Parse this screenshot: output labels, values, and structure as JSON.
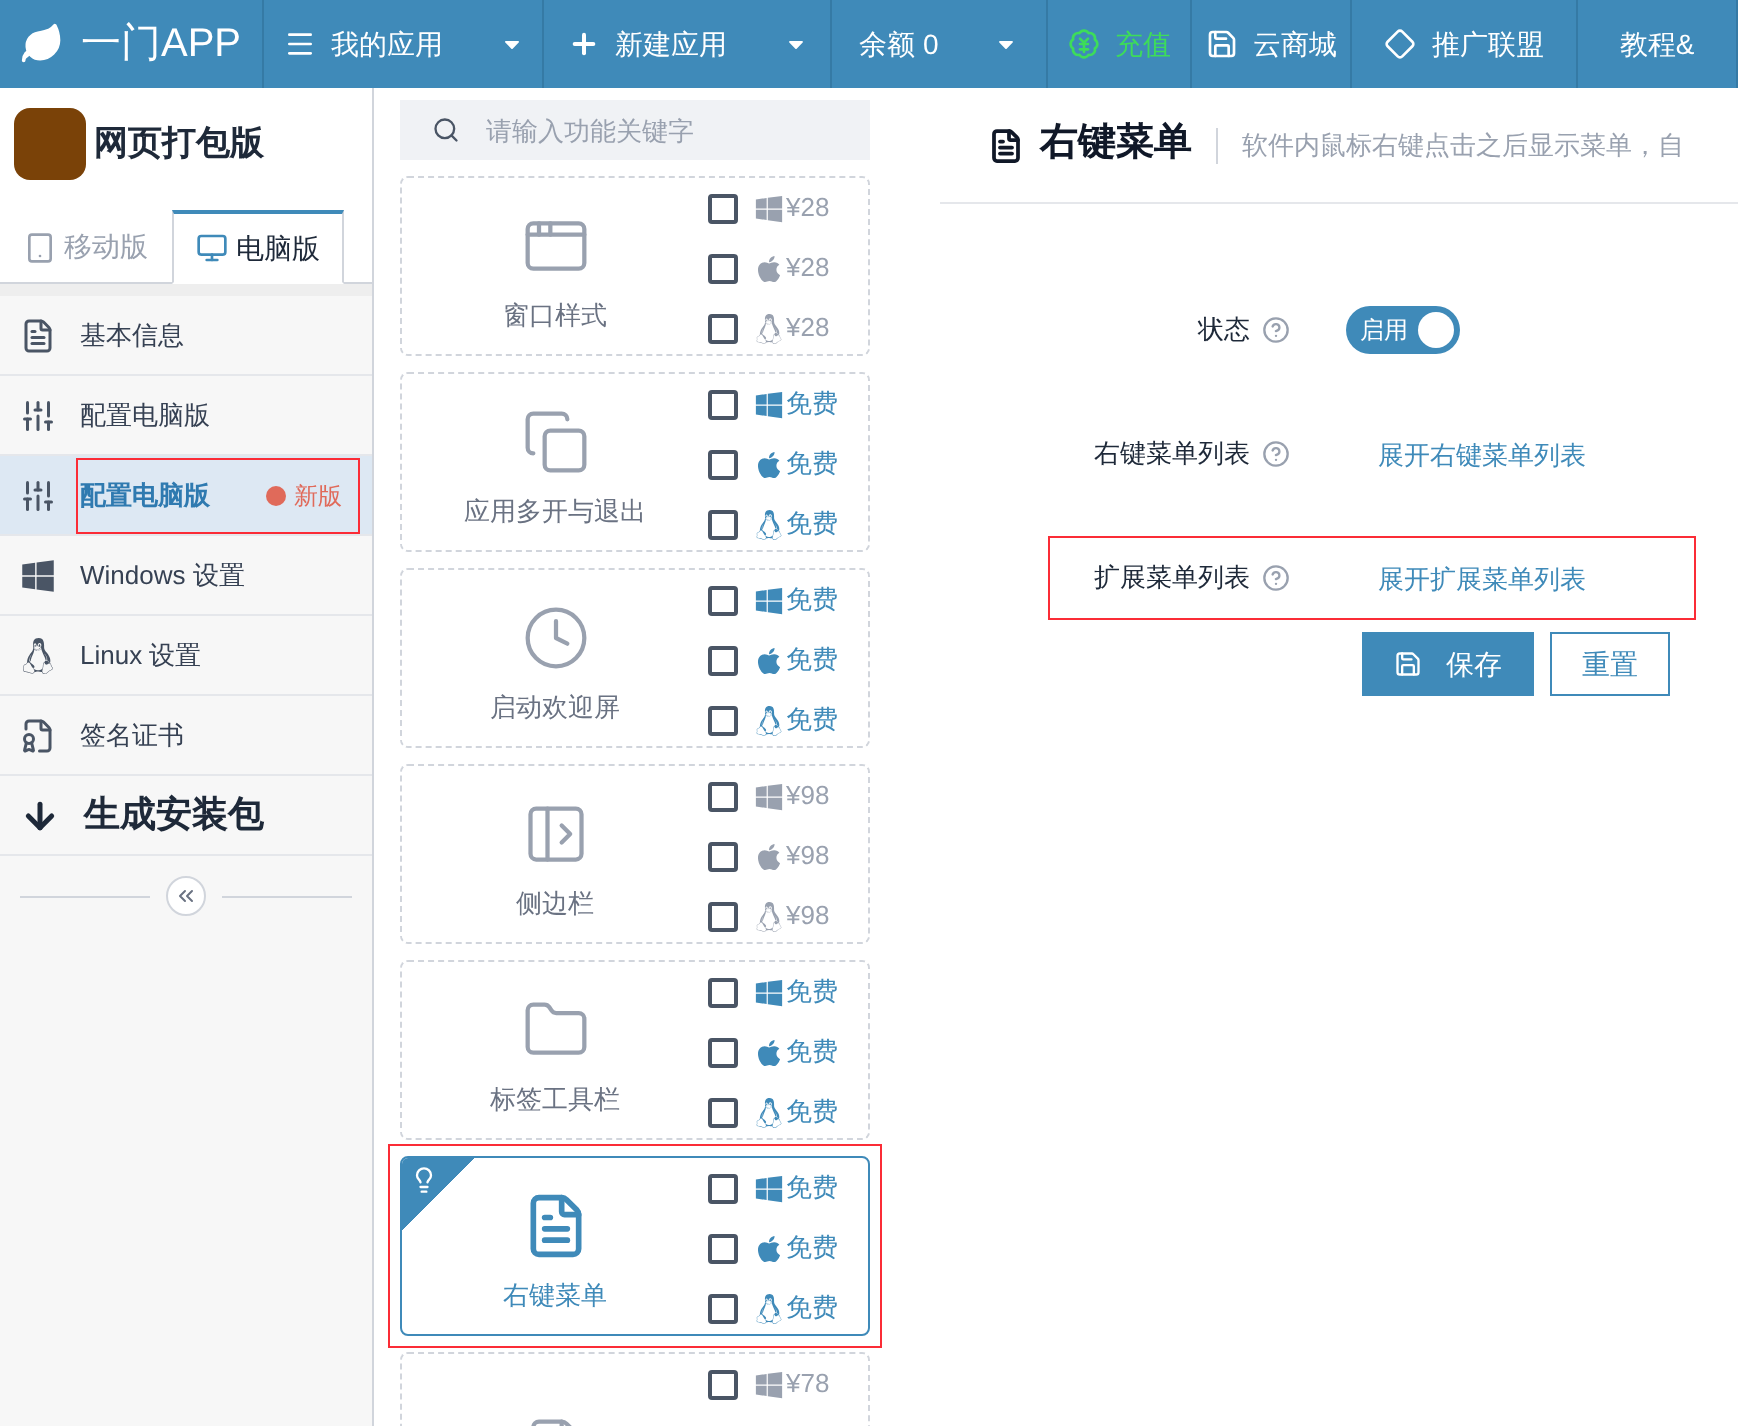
{
  "nav": {
    "logo": "一门APP",
    "items": [
      {
        "label": "我的应用",
        "kind": "apps",
        "dropdown": true
      },
      {
        "label": "新建应用",
        "kind": "new",
        "dropdown": true
      },
      {
        "label": "余额 0",
        "kind": "balance",
        "dropdown": true
      },
      {
        "label": "充值",
        "kind": "recharge",
        "dropdown": false
      },
      {
        "label": "云商城",
        "kind": "store",
        "dropdown": false
      },
      {
        "label": "推广联盟",
        "kind": "affiliate",
        "dropdown": false
      },
      {
        "label": "教程&",
        "kind": "plain",
        "dropdown": false
      }
    ]
  },
  "sidebar": {
    "app_name": "网页打包版",
    "tabs": [
      {
        "label": "移动版",
        "kind": "mobile",
        "selected": false
      },
      {
        "label": "电脑版",
        "kind": "desktop",
        "selected": true
      }
    ],
    "items": [
      {
        "label": "基本信息",
        "kind": "info",
        "selected": false,
        "highlighted": false
      },
      {
        "label": "配置电脑版",
        "kind": "config",
        "selected": false,
        "highlighted": false
      },
      {
        "label": "配置电脑版",
        "kind": "config",
        "selected": true,
        "highlighted": true,
        "badge": "新版"
      },
      {
        "label": "Windows 设置",
        "kind": "windows",
        "selected": false,
        "highlighted": false
      },
      {
        "label": "Linux 设置",
        "kind": "linux",
        "selected": false,
        "highlighted": false
      },
      {
        "label": "签名证书",
        "kind": "cert",
        "selected": false,
        "highlighted": false
      },
      {
        "label": "生成安装包",
        "kind": "build",
        "selected": false,
        "highlighted": false
      }
    ]
  },
  "features": {
    "search": {
      "placeholder": "请输入功能关键字"
    },
    "cards": [
      {
        "name": "窗口样式",
        "kind": "window",
        "selected": false,
        "highlighted": false,
        "options": [
          {
            "kind": "windows",
            "price": "¥28",
            "paid": true,
            "checked": false
          },
          {
            "kind": "apple",
            "price": "¥28",
            "paid": true,
            "checked": false
          },
          {
            "kind": "linux",
            "price": "¥28",
            "paid": true,
            "checked": false
          }
        ]
      },
      {
        "name": "应用多开与退出",
        "kind": "multi",
        "selected": false,
        "highlighted": false,
        "options": [
          {
            "kind": "windows",
            "price": "免费",
            "paid": false,
            "checked": false
          },
          {
            "kind": "apple",
            "price": "免费",
            "paid": false,
            "checked": false
          },
          {
            "kind": "linux",
            "price": "免费",
            "paid": false,
            "checked": false
          }
        ]
      },
      {
        "name": "启动欢迎屏",
        "kind": "clock",
        "selected": false,
        "highlighted": false,
        "options": [
          {
            "kind": "windows",
            "price": "免费",
            "paid": false,
            "checked": false
          },
          {
            "kind": "apple",
            "price": "免费",
            "paid": false,
            "checked": false
          },
          {
            "kind": "linux",
            "price": "免费",
            "paid": false,
            "checked": false
          }
        ]
      },
      {
        "name": "侧边栏",
        "kind": "sidebar",
        "selected": false,
        "highlighted": false,
        "options": [
          {
            "kind": "windows",
            "price": "¥98",
            "paid": true,
            "checked": false
          },
          {
            "kind": "apple",
            "price": "¥98",
            "paid": true,
            "checked": false
          },
          {
            "kind": "linux",
            "price": "¥98",
            "paid": true,
            "checked": false
          }
        ]
      },
      {
        "name": "标签工具栏",
        "kind": "tabs",
        "selected": false,
        "highlighted": false,
        "options": [
          {
            "kind": "windows",
            "price": "免费",
            "paid": false,
            "checked": false
          },
          {
            "kind": "apple",
            "price": "免费",
            "paid": false,
            "checked": false
          },
          {
            "kind": "linux",
            "price": "免费",
            "paid": false,
            "checked": false
          }
        ]
      },
      {
        "name": "右键菜单",
        "kind": "menu",
        "selected": true,
        "highlighted": true,
        "options": [
          {
            "kind": "windows",
            "price": "免费",
            "paid": false,
            "checked": false
          },
          {
            "kind": "apple",
            "price": "免费",
            "paid": false,
            "checked": false
          },
          {
            "kind": "linux",
            "price": "免费",
            "paid": false,
            "checked": false
          }
        ]
      },
      {
        "kind": "css",
        "selected": false,
        "highlighted": false,
        "options": [
          {
            "kind": "windows",
            "price": "¥78",
            "paid": true,
            "checked": false
          }
        ]
      }
    ]
  },
  "panel": {
    "title": "右键菜单",
    "description": "软件内鼠标右键点击之后显示菜单，自",
    "fields": [
      {
        "label": "状态",
        "kind": "toggle",
        "value": "启用",
        "on": true,
        "highlighted": false
      },
      {
        "label": "右键菜单列表",
        "kind": "link",
        "value": "展开右键菜单列表",
        "highlighted": false
      },
      {
        "label": "扩展菜单列表",
        "kind": "link",
        "value": "展开扩展菜单列表",
        "highlighted": true
      }
    ],
    "buttons": [
      {
        "label": "保存",
        "kind": "primary"
      },
      {
        "label": "重置",
        "kind": "default"
      }
    ]
  }
}
